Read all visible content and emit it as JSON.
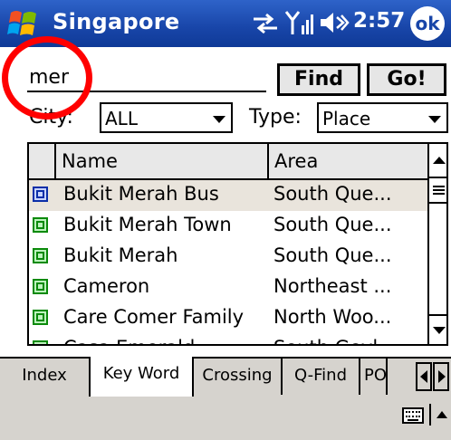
{
  "titlebar": {
    "title": "Singapore",
    "time": "2:57",
    "ok_label": "ok"
  },
  "search": {
    "value": "mer",
    "find_label": "Find",
    "go_label": "Go!"
  },
  "filters": {
    "city_label": "City:",
    "city_value": "ALL",
    "type_label": "Type:",
    "type_value": "Place"
  },
  "list": {
    "columns": [
      "Name",
      "Area"
    ],
    "rows": [
      {
        "name": "Bukit Merah Bus",
        "area": "South Que...",
        "icon": "bus-stop-icon"
      },
      {
        "name": "Bukit Merah Town",
        "area": "South Que...",
        "icon": "building-icon"
      },
      {
        "name": "Bukit Merah",
        "area": "South Que...",
        "icon": "building-icon"
      },
      {
        "name": "Cameron",
        "area": "Northeast ...",
        "icon": "building-icon"
      },
      {
        "name": "Care Comer Family",
        "area": "North Woo...",
        "icon": "building-icon"
      },
      {
        "name": "Casa Emerald",
        "area": "South Geyl...",
        "icon": "building-icon"
      }
    ]
  },
  "tabs": [
    "Index",
    "Key Word",
    "Crossing",
    "Q-Find",
    "POI"
  ],
  "active_tab": "Key Word",
  "colors": {
    "titlebar": "#1845a8",
    "highlight_circle": "#ff0000",
    "selected_row": "#e9e4dc",
    "building_icon": "#0a8a0a",
    "bus_icon": "#0b2ea8"
  }
}
